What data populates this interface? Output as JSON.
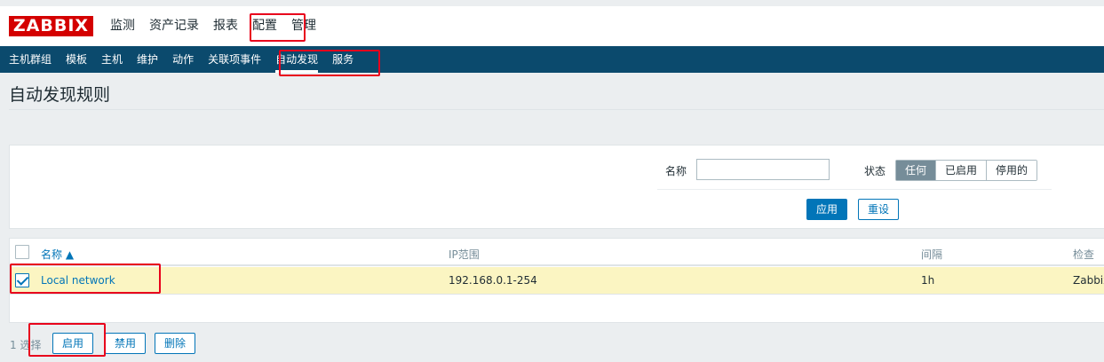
{
  "brand": {
    "logo_text": "ZABBIX",
    "logo_color": "#d40000"
  },
  "main_nav": {
    "items": [
      "监测",
      "资产记录",
      "报表",
      "配置",
      "管理"
    ],
    "selected": "配置"
  },
  "sub_nav": {
    "items": [
      "主机群组",
      "模板",
      "主机",
      "维护",
      "动作",
      "关联项事件",
      "自动发现",
      "服务"
    ],
    "selected": "自动发现"
  },
  "page": {
    "title": "自动发现规则"
  },
  "filter": {
    "name_label": "名称",
    "name_value": "",
    "status_label": "状态",
    "status_options": [
      "任何",
      "已启用",
      "停用的"
    ],
    "status_selected": "任何",
    "apply_label": "应用",
    "reset_label": "重设"
  },
  "table": {
    "columns": [
      "名称 ▲",
      "IP范围",
      "间隔",
      "检查"
    ],
    "rows": [
      {
        "checked": true,
        "name": "Local network",
        "ip_range": "192.168.0.1-254",
        "interval": "1h",
        "checks": "Zabbix"
      }
    ]
  },
  "footer": {
    "selected_text": "1 选择",
    "enable_label": "启用",
    "disable_label": "禁用",
    "delete_label": "删除"
  },
  "colors": {
    "nav_bg": "#0b4a6d",
    "accent": "#0275b8",
    "row_highlight": "#fbf5c2",
    "annotation": "#e8001c"
  }
}
